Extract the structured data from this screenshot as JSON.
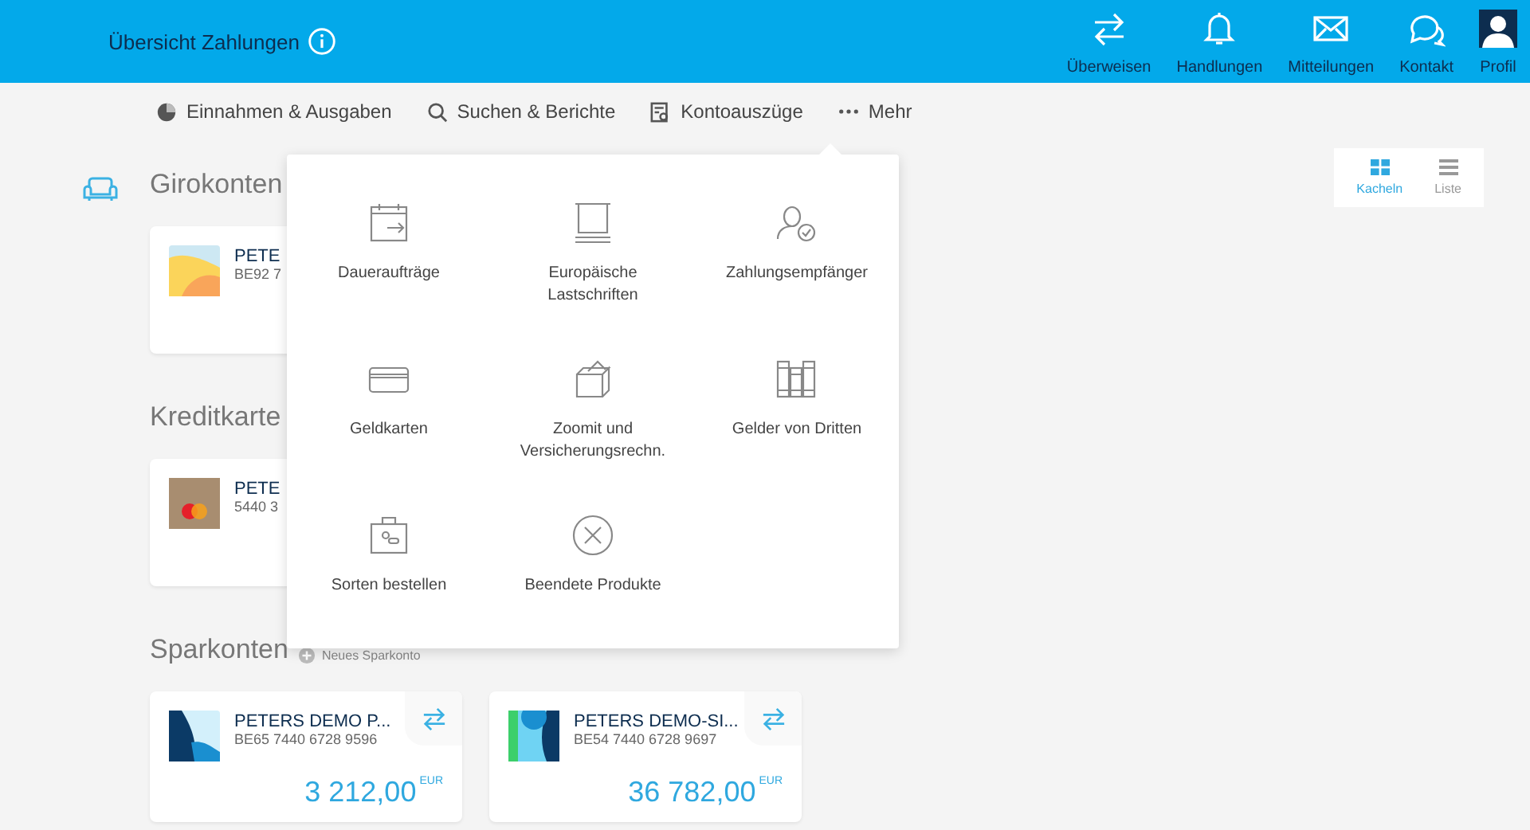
{
  "header": {
    "title": "Übersicht Zahlungen",
    "actions": [
      {
        "label": "Überweisen"
      },
      {
        "label": "Handlungen"
      },
      {
        "label": "Mitteilungen"
      },
      {
        "label": "Kontakt"
      },
      {
        "label": "Profil"
      }
    ]
  },
  "subnav": [
    {
      "label": "Einnahmen & Ausgaben"
    },
    {
      "label": "Suchen & Berichte"
    },
    {
      "label": "Kontoauszüge"
    },
    {
      "label": "Mehr"
    }
  ],
  "view_toggle": [
    {
      "label": "Kacheln",
      "selected": true
    },
    {
      "label": "Liste",
      "selected": false
    }
  ],
  "sections": [
    {
      "title": "Girokonten",
      "cards": [
        {
          "kind": "sunset",
          "name": "PETE",
          "number": "BE92 7"
        }
      ]
    },
    {
      "title": "Kreditkarte",
      "cards": [
        {
          "kind": "mastercard",
          "name": "PETE",
          "number": "5440 3"
        }
      ]
    },
    {
      "title": "Sparkonten",
      "link": "Neues Sparkonto",
      "cards": [
        {
          "kind": "navy",
          "name": "PETERS DEMO P...",
          "number": "BE65 7440 6728 9596",
          "amount": "3 212,00",
          "currency": "EUR"
        },
        {
          "kind": "green",
          "name": "PETERS DEMO-SI...",
          "number": "BE54 7440 6728 9697",
          "amount": "36 782,00",
          "currency": "EUR"
        }
      ]
    }
  ],
  "menu": [
    {
      "label": "Daueraufträge"
    },
    {
      "label": "Europäische Lastschriften"
    },
    {
      "label": "Zahlungsempfänger"
    },
    {
      "label": "Geldkarten"
    },
    {
      "label": "Zoomit und Versicherungsrechn."
    },
    {
      "label": "Gelder von Dritten"
    },
    {
      "label": "Sorten bestellen"
    },
    {
      "label": "Beendete Produkte"
    }
  ]
}
